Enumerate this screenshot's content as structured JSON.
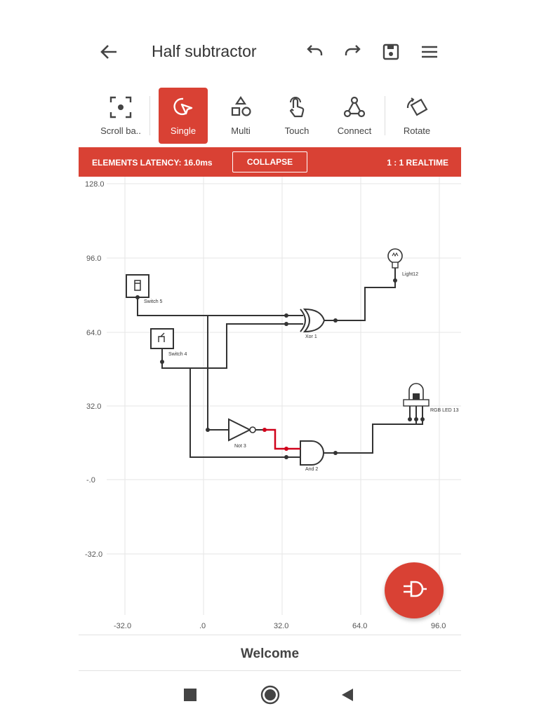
{
  "header": {
    "title": "Half subtractor",
    "icons": [
      "back-arrow-icon",
      "undo-icon",
      "redo-icon",
      "save-icon",
      "menu-icon"
    ]
  },
  "toolbar": {
    "tools": [
      {
        "label": "Scroll ba..",
        "icon": "scroll-icon",
        "active": false
      },
      {
        "label": "Single",
        "icon": "single-select-icon",
        "active": true
      },
      {
        "label": "Multi",
        "icon": "multi-select-icon",
        "active": false
      },
      {
        "label": "Touch",
        "icon": "touch-icon",
        "active": false
      },
      {
        "label": "Connect",
        "icon": "connect-icon",
        "active": false
      },
      {
        "label": "Rotate",
        "icon": "rotate-icon",
        "active": false
      }
    ]
  },
  "status_bar": {
    "latency": "ELEMENTS LATENCY: 16.0ms",
    "collapse_label": "COLLAPSE",
    "realtime": "1 : 1 REALTIME",
    "color": "#d94134"
  },
  "canvas": {
    "y_labels": [
      "128.0",
      "96.0",
      "64.0",
      "32.0",
      "-.0",
      "-32.0"
    ],
    "x_labels": [
      "-32.0",
      ".0",
      "32.0",
      "64.0",
      "96.0"
    ],
    "components": {
      "switch5": "Switch 5",
      "switch4": "Switch 4",
      "xor1": "Xor 1",
      "light12": "Light12",
      "not3": "Not 3",
      "and2": "And 2",
      "rgbled13": "RGB LED 13"
    },
    "active_wire_color": "#d0021b"
  },
  "fab": {
    "icon": "add-gate-icon"
  },
  "footer": {
    "welcome": "Welcome"
  },
  "navbar": {
    "icons": [
      "recents-icon",
      "home-icon",
      "back-icon"
    ]
  }
}
